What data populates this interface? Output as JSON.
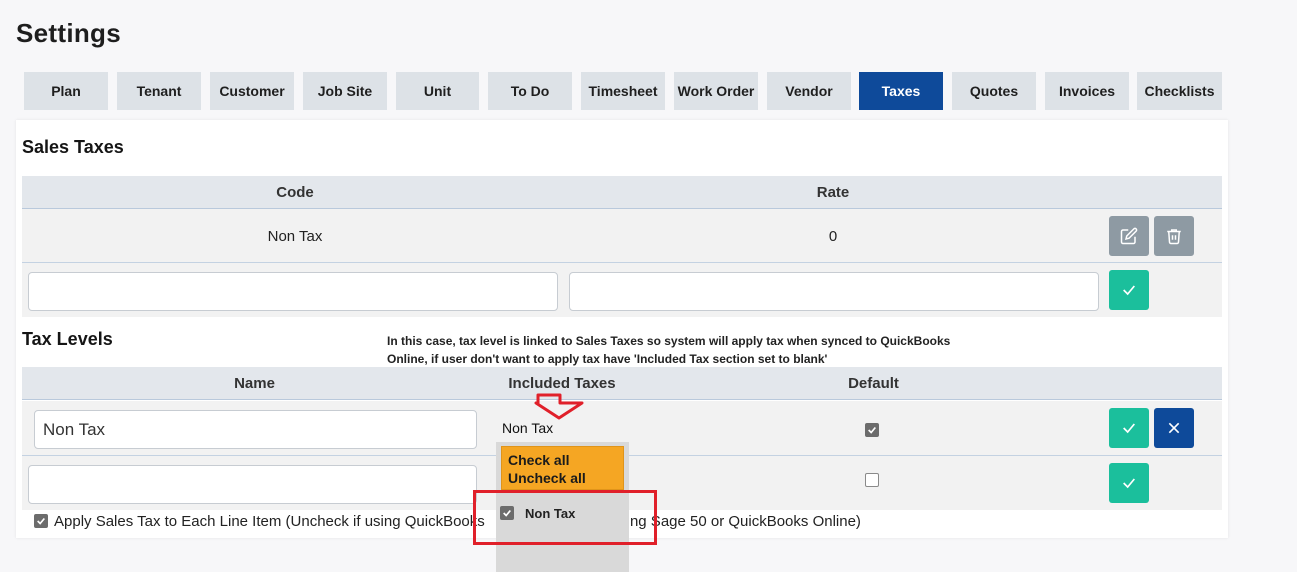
{
  "page": {
    "title": "Settings"
  },
  "tabs": [
    {
      "label": "Plan",
      "active": false
    },
    {
      "label": "Tenant",
      "active": false
    },
    {
      "label": "Customer",
      "active": false
    },
    {
      "label": "Job Site",
      "active": false
    },
    {
      "label": "Unit",
      "active": false
    },
    {
      "label": "To Do",
      "active": false
    },
    {
      "label": "Timesheet",
      "active": false
    },
    {
      "label": "Work Order",
      "active": false
    },
    {
      "label": "Vendor",
      "active": false
    },
    {
      "label": "Taxes",
      "active": true
    },
    {
      "label": "Quotes",
      "active": false
    },
    {
      "label": "Invoices",
      "active": false
    },
    {
      "label": "Checklists",
      "active": false
    }
  ],
  "sales_taxes": {
    "title": "Sales Taxes",
    "columns": {
      "code": "Code",
      "rate": "Rate"
    },
    "rows": [
      {
        "code": "Non Tax",
        "rate": "0"
      }
    ],
    "new_row": {
      "code_value": "",
      "rate_value": ""
    }
  },
  "tax_levels": {
    "title": "Tax Levels",
    "note": "In this case, tax level is linked to Sales Taxes so system will apply tax when synced to QuickBooks Online, if user don't want to apply tax have 'Included Tax section set to blank'",
    "columns": {
      "name": "Name",
      "included_taxes": "Included Taxes",
      "default": "Default"
    },
    "rows": [
      {
        "name": "Non Tax",
        "included_taxes": "Non Tax",
        "default": true
      }
    ],
    "new_row": {
      "name_value": "",
      "default": false
    }
  },
  "dropdown": {
    "selected": "Non Tax",
    "check_all": "Check all",
    "uncheck_all": "Uncheck all",
    "options": [
      {
        "label": "Non Tax",
        "checked": true
      }
    ]
  },
  "footer": {
    "apply_tax_label_left": "Apply Sales Tax to Each Line Item (Uncheck if using QuickBooks",
    "apply_tax_label_right": "using Sage 50 or QuickBooks Online)",
    "apply_tax_checked": true
  },
  "colors": {
    "active_tab": "#0e4a9a",
    "confirm_button": "#1bbf9c",
    "edit_button": "#8e9aa3",
    "cancel_button": "#0e4a9a",
    "dropdown_actions": "#f5a623",
    "highlight_annotation": "#e0202a"
  },
  "icons": {
    "edit": "edit-icon",
    "delete": "trash-icon",
    "confirm": "check-icon",
    "cancel": "close-icon",
    "annotation_arrow": "down-arrow-icon"
  }
}
